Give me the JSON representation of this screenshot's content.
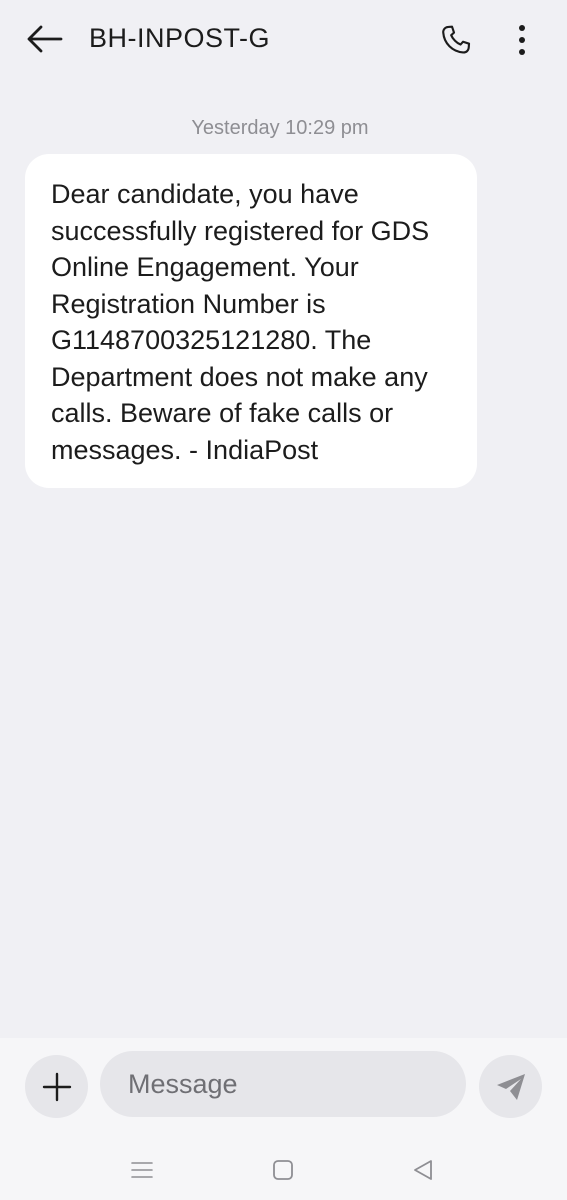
{
  "header": {
    "title": "BH-INPOST-G",
    "back_icon": "arrow-left-icon",
    "call_icon": "phone-icon",
    "more_icon": "more-vertical-icon"
  },
  "conversation": {
    "timestamp": "Yesterday 10:29 pm",
    "messages": [
      {
        "direction": "incoming",
        "text": "Dear candidate, you have successfully registered for GDS Online Engagement. Your Registration Number is G1148700325121280. The Department does not make any calls. Beware of fake calls or messages. - IndiaPost"
      }
    ]
  },
  "composer": {
    "placeholder": "Message",
    "value": "",
    "add_icon": "plus-icon",
    "send_icon": "send-icon"
  },
  "system_nav": {
    "menu_icon": "menu-icon",
    "home_icon": "home-square-icon",
    "back_icon": "back-triangle-icon"
  },
  "colors": {
    "background": "#f0f0f4",
    "bubble": "#ffffff",
    "text": "#1c1c1c",
    "secondary_text": "#8e8e93"
  }
}
